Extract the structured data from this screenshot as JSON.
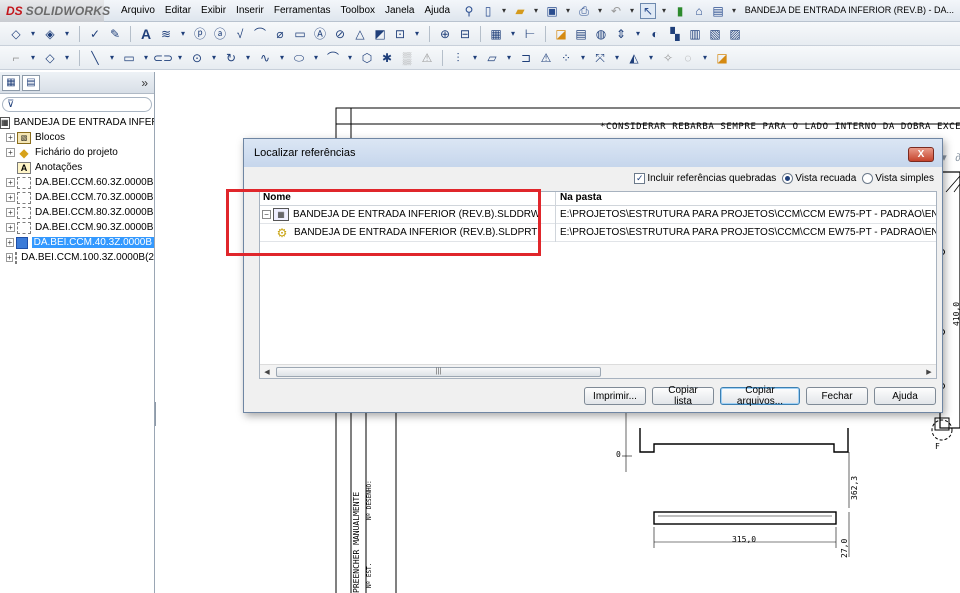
{
  "app": {
    "logo_ds": "DS",
    "logo_name": "SOLIDWORKS",
    "menu": [
      "Arquivo",
      "Editar",
      "Exibir",
      "Inserir",
      "Ferramentas",
      "Toolbox",
      "Janela",
      "Ajuda"
    ],
    "document_title": "BANDEJA DE ENTRADA INFERIOR (REV.B) - DA..."
  },
  "feature_tree": {
    "root": "BANDEJA DE ENTRADA INFERI",
    "items": [
      {
        "label": "Blocos"
      },
      {
        "label": "Fichário do projeto"
      },
      {
        "label": "Anotações"
      },
      {
        "label": "DA.BEI.CCM.60.3Z.0000B"
      },
      {
        "label": "DA.BEI.CCM.70.3Z.0000B"
      },
      {
        "label": "DA.BEI.CCM.80.3Z.0000B"
      },
      {
        "label": "DA.BEI.CCM.90.3Z.0000B"
      },
      {
        "label": "DA.BEI.CCM.40.3Z.0000B"
      },
      {
        "label": "DA.BEI.CCM.100.3Z.0000B(2"
      }
    ]
  },
  "drawing": {
    "note": "*CONSIDERAR REBARBA SEMPRE PARA O LADO INTERNO DA DOBRA EXCE",
    "dims": [
      "0",
      "362,3",
      "315,0",
      "27,0",
      "410,0"
    ],
    "label_f": "F",
    "side_text_1": "PREENCHER MANUALMENTE",
    "side_text_2": "Nº DESENHO:",
    "side_text_3": "Nº EST."
  },
  "dialog": {
    "title": "Localizar referências",
    "close": "X",
    "opt_broken": "Incluir referências quebradas",
    "opt_indented": "Vista recuada",
    "opt_flat": "Vista simples",
    "col_name": "Nome",
    "col_path": "Na pasta",
    "rows": [
      {
        "name": "BANDEJA DE ENTRADA INFERIOR (REV.B).SLDDRW",
        "path": "E:\\PROJETOS\\ESTRUTURA PARA PROJETOS\\CCM\\CCM EW75-PT - PADRÃO\\ENTRADA"
      },
      {
        "name": "BANDEJA DE ENTRADA INFERIOR (REV.B).SLDPRT",
        "path": "E:\\PROJETOS\\ESTRUTURA PARA PROJETOS\\CCM\\CCM EW75-PT - PADRÃO\\ENTRADA"
      }
    ],
    "buttons": {
      "print": "Imprimir...",
      "copy_list": "Copiar lista",
      "copy_files": "Copiar arquivos...",
      "close": "Fechar",
      "help": "Ajuda"
    }
  }
}
